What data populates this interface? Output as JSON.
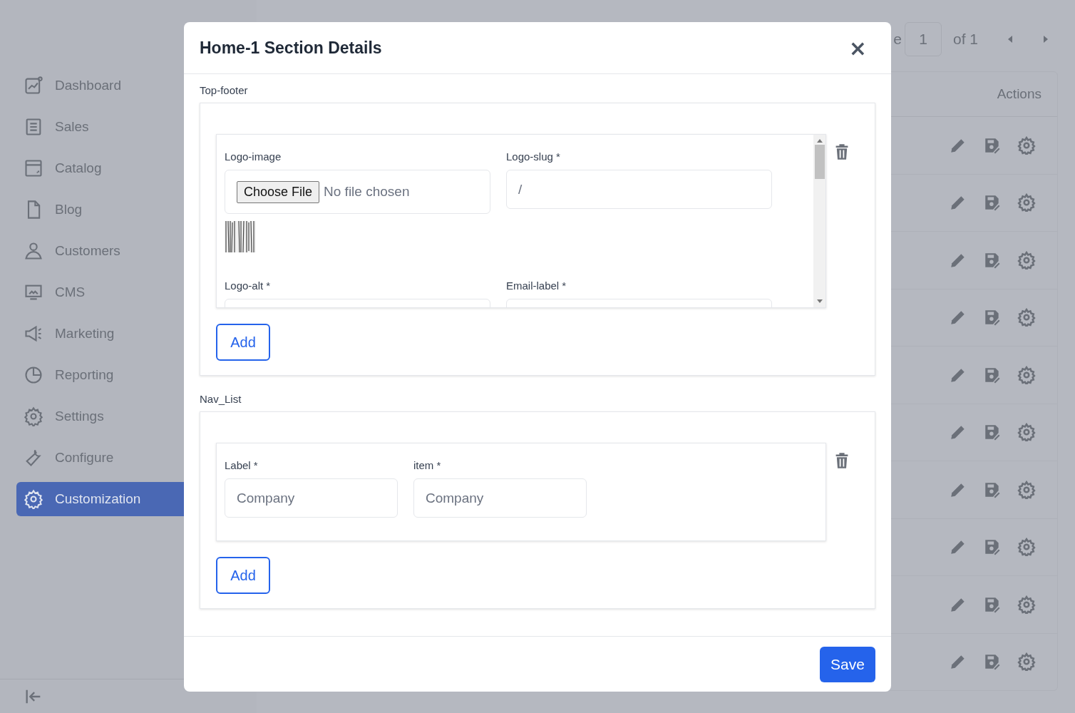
{
  "sidebar": {
    "items": [
      {
        "label": "Dashboard",
        "selected": false
      },
      {
        "label": "Sales",
        "selected": false
      },
      {
        "label": "Catalog",
        "selected": false
      },
      {
        "label": "Blog",
        "selected": false
      },
      {
        "label": "Customers",
        "selected": false
      },
      {
        "label": "CMS",
        "selected": false
      },
      {
        "label": "Marketing",
        "selected": false
      },
      {
        "label": "Reporting",
        "selected": false
      },
      {
        "label": "Settings",
        "selected": false
      },
      {
        "label": "Configure",
        "selected": false
      },
      {
        "label": "Customization",
        "selected": true
      }
    ]
  },
  "pagination": {
    "label": "e",
    "page": "1",
    "total": "of 1"
  },
  "table": {
    "columns": [
      "Actions"
    ]
  },
  "modal": {
    "title": "Home-1 Section Details",
    "close": "×",
    "sections": [
      {
        "title": "Top-footer",
        "scrollable": true,
        "fields": [
          {
            "kind": "file",
            "label": "Logo-image",
            "button": "Choose File",
            "status": "No file chosen",
            "preview": true
          },
          {
            "kind": "text",
            "label": "Logo-slug *",
            "value": "/"
          },
          {
            "kind": "text",
            "label": "Logo-alt *"
          },
          {
            "kind": "text",
            "label": "Email-label *"
          }
        ],
        "add": "Add"
      },
      {
        "title": "Nav_List",
        "scrollable": false,
        "fields": [
          {
            "kind": "text",
            "label": "Label *",
            "value": "Company"
          },
          {
            "kind": "text",
            "label": "item *",
            "value": "Company"
          }
        ],
        "add": "Add"
      }
    ],
    "save": "Save"
  }
}
